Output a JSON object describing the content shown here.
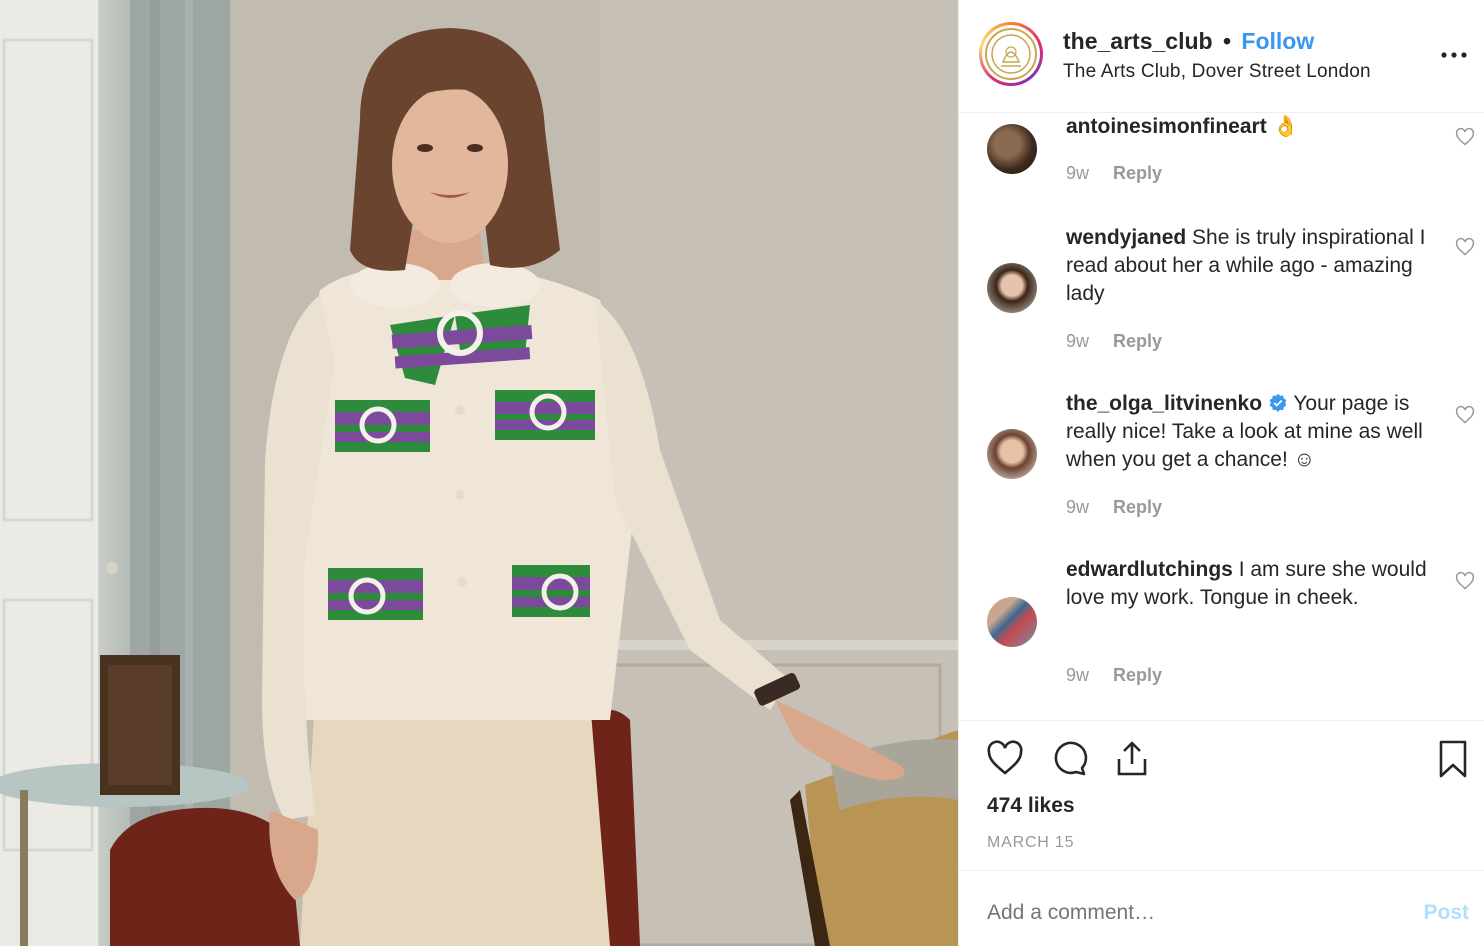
{
  "post": {
    "photo_alt": "Woman in cream jacket with green and purple bows",
    "colors": {
      "follow": "#3897f0",
      "post_button": "#b2dffc",
      "verified": "#3897f0"
    }
  },
  "header": {
    "username": "the_arts_club",
    "separator": "•",
    "follow_label": "Follow",
    "location": "The Arts Club, Dover Street London",
    "more_label": "•••",
    "logo_year": "1863",
    "logo_letters": "A C"
  },
  "comments": [
    {
      "username": "antoinesimonfineart",
      "text": " 👌",
      "time": "9w",
      "reply": "Reply",
      "verified": false
    },
    {
      "username": "wendyjaned",
      "text": " She is truly inspirational I read about her a while ago - amazing lady",
      "time": "9w",
      "reply": "Reply",
      "verified": false
    },
    {
      "username": "the_olga_litvinenko",
      "text": " Your page is really nice! Take a look at mine as well when you get a chance! ☺",
      "time": "9w",
      "reply": "Reply",
      "verified": true
    },
    {
      "username": "edwardlutchings",
      "text": " I am sure she would love my work. Tongue in cheek.",
      "time": "9w",
      "reply": "Reply",
      "verified": false
    }
  ],
  "actions": {
    "likes": "474 likes",
    "date": "MARCH 15"
  },
  "add_comment": {
    "placeholder": "Add a comment…",
    "post_label": "Post"
  }
}
